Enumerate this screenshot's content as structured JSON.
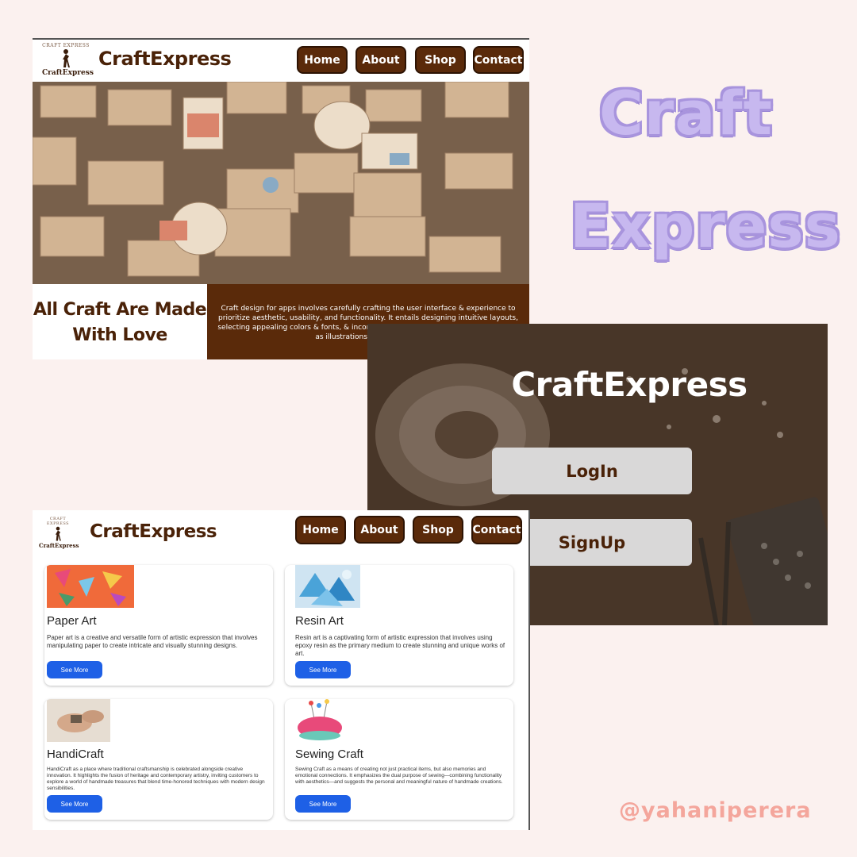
{
  "colors": {
    "background": "#fbf1ef",
    "brand_brown": "#5a2a0a",
    "headline_brown": "#4a2208",
    "side_title_lavender": "#c7b8ef",
    "handle_pink": "#f4a69c",
    "button_blue": "#1e60e6",
    "auth_button_gray": "#d9d8d8"
  },
  "side_brand": {
    "line1": "Craft",
    "line2": "Express",
    "handle": "@yahaniperera"
  },
  "home": {
    "logo_top_text": "CRAFT EXPRESS",
    "logo_word": "CraftExpress",
    "brand": "CraftExpress",
    "nav": [
      "Home",
      "About",
      "Shop",
      "Contact"
    ],
    "headline_line1": "All Craft Are Made",
    "headline_line2": "With Love",
    "description": "Craft design for apps involves carefully crafting the user interface & experience to prioritize aesthetic, usability, and functionality. It entails designing intuitive layouts, selecting appealing colors & fonts, & incorporating visually engaging elements such as illustrations or animations."
  },
  "login": {
    "title": "CraftExpress",
    "login_label": "LogIn",
    "signup_label": "SignUp"
  },
  "shop": {
    "logo_top_text": "CRAFT EXPRESS",
    "logo_word": "CraftExpress",
    "brand": "CraftExpress",
    "nav": [
      "Home",
      "About",
      "Shop",
      "Contact"
    ],
    "cards": [
      {
        "title": "Paper Art",
        "description": "Paper art is a creative and versatile form of artistic expression that involves manipulating paper to create intricate and visually stunning designs.",
        "button": "See More",
        "image_icon": "paper-origami-image"
      },
      {
        "title": "Resin Art",
        "description": "Resin art is a captivating form of artistic expression that involves using epoxy resin as the primary medium to create stunning and unique works of art.",
        "button": "See More",
        "image_icon": "resin-art-image"
      },
      {
        "title": "HandiCraft",
        "description": "HandiCraft as a place where traditional craftsmanship is celebrated alongside creative innovation. It highlights the fusion of heritage and contemporary artistry, inviting customers to explore a world of handmade treasures that blend time-honored techniques with modern design sensibilities.",
        "button": "See More",
        "image_icon": "handicraft-image"
      },
      {
        "title": "Sewing Craft",
        "description": "Sewing Craft as a means of creating not just practical items, but also memories and emotional connections. It emphasizes the dual purpose of sewing—combining functionality with aesthetics—and suggests the personal and meaningful nature of handmade creations.",
        "button": "See More",
        "image_icon": "pincushion-image"
      }
    ]
  }
}
